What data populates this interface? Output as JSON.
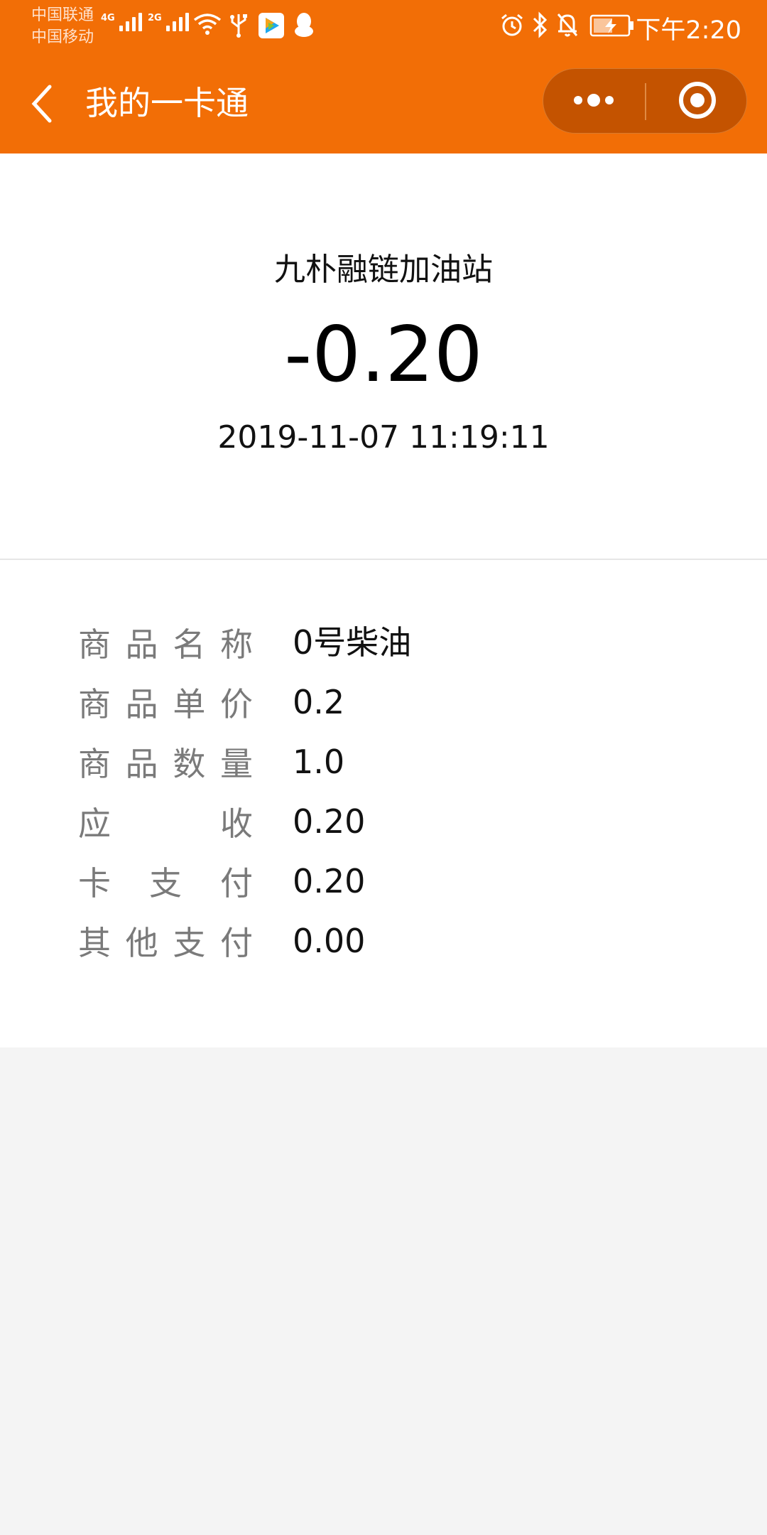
{
  "status_bar": {
    "carrier_1": "中国联通",
    "carrier_2": "中国移动",
    "network_1": "4G",
    "network_2": "2G",
    "time": "下午2:20",
    "icons": [
      "signal-icon",
      "signal-icon",
      "wifi-icon",
      "usb-icon",
      "tencent-video-icon",
      "qq-icon",
      "alarm-icon",
      "bluetooth-icon",
      "mute-icon",
      "battery-charging-icon"
    ]
  },
  "nav": {
    "title": "我的一卡通",
    "back_icon": "chevron-left-icon",
    "more_icon": "more-dots-icon",
    "close_icon": "target-circle-icon"
  },
  "transaction": {
    "merchant": "九朴融链加油站",
    "amount": "-0.20",
    "datetime": "2019-11-07 11:19:11"
  },
  "details": [
    {
      "label_chars": [
        "商",
        "品",
        "名",
        "称"
      ],
      "value": "0号柴油"
    },
    {
      "label_chars": [
        "商",
        "品",
        "单",
        "价"
      ],
      "value": "0.2"
    },
    {
      "label_chars": [
        "商",
        "品",
        "数",
        "量"
      ],
      "value": "1.0"
    },
    {
      "label_chars": [
        "应",
        "收"
      ],
      "value": "0.20"
    },
    {
      "label_chars": [
        "卡",
        "支",
        "付"
      ],
      "value": "0.20"
    },
    {
      "label_chars": [
        "其",
        "他",
        "支",
        "付"
      ],
      "value": "0.00"
    }
  ],
  "colors": {
    "brand": "#f26e06",
    "capsule": "#c45300",
    "label": "#7a7a7a",
    "page_bg": "#f4f4f4"
  }
}
